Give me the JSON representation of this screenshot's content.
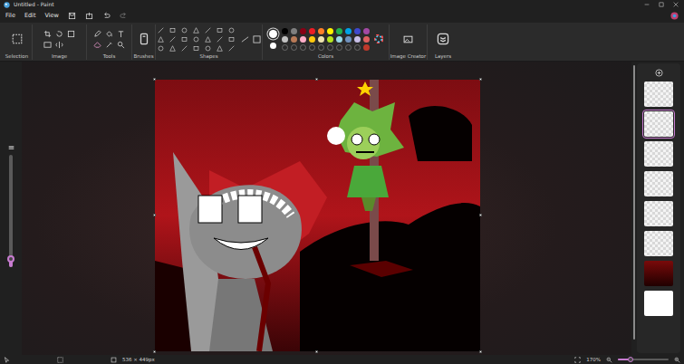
{
  "window": {
    "title": "Untitled - Paint"
  },
  "menu": [
    {
      "label": "File"
    },
    {
      "label": "Edit"
    },
    {
      "label": "View"
    }
  ],
  "ribbon": {
    "groups": [
      {
        "label": "Selection"
      },
      {
        "label": "Image"
      },
      {
        "label": "Tools"
      },
      {
        "label": "Brushes"
      },
      {
        "label": "Shapes"
      },
      {
        "label": "Colors"
      },
      {
        "label": "Image Creator"
      },
      {
        "label": "Layers"
      }
    ]
  },
  "palette": {
    "primary": "#ffffff",
    "secondary": "#ffffff",
    "swatches": [
      {
        "kind": "color",
        "color": "#000000"
      },
      {
        "kind": "color",
        "color": "#7f7f7f"
      },
      {
        "kind": "color",
        "color": "#880015"
      },
      {
        "kind": "color",
        "color": "#ed1c24"
      },
      {
        "kind": "color",
        "color": "#ff7f27"
      },
      {
        "kind": "color",
        "color": "#fff200"
      },
      {
        "kind": "color",
        "color": "#22b14c"
      },
      {
        "kind": "color",
        "color": "#00a2e8"
      },
      {
        "kind": "color",
        "color": "#3f48cc"
      },
      {
        "kind": "color",
        "color": "#a349a4"
      },
      {
        "kind": "color",
        "color": "#c3c3c3"
      },
      {
        "kind": "color",
        "color": "#b97a57"
      },
      {
        "kind": "color",
        "color": "#ffaec9"
      },
      {
        "kind": "color",
        "color": "#ffc90e"
      },
      {
        "kind": "color",
        "color": "#efe4b0"
      },
      {
        "kind": "color",
        "color": "#b5e61d"
      },
      {
        "kind": "color",
        "color": "#99d9ea"
      },
      {
        "kind": "color",
        "color": "#7092be"
      },
      {
        "kind": "color",
        "color": "#c8bfe7"
      },
      {
        "kind": "color",
        "color": "#e06060"
      },
      {
        "kind": "empty"
      },
      {
        "kind": "empty"
      },
      {
        "kind": "empty"
      },
      {
        "kind": "empty"
      },
      {
        "kind": "empty"
      },
      {
        "kind": "empty"
      },
      {
        "kind": "empty"
      },
      {
        "kind": "empty"
      },
      {
        "kind": "empty"
      },
      {
        "kind": "color",
        "color": "#c0392b"
      }
    ]
  },
  "brush_size_slider": {
    "level": 0.07
  },
  "layers": [
    {
      "kind": "transparent",
      "selected": false
    },
    {
      "kind": "transparent",
      "selected": true
    },
    {
      "kind": "transparent",
      "selected": false
    },
    {
      "kind": "transparent",
      "selected": false
    },
    {
      "kind": "transparent",
      "selected": false
    },
    {
      "kind": "transparent",
      "selected": false
    },
    {
      "kind": "red",
      "selected": false
    },
    {
      "kind": "white",
      "selected": false
    }
  ],
  "status_bar": {
    "canvas_size": "536 × 449px",
    "zoom": "170%",
    "zoom_level": 0.25
  }
}
